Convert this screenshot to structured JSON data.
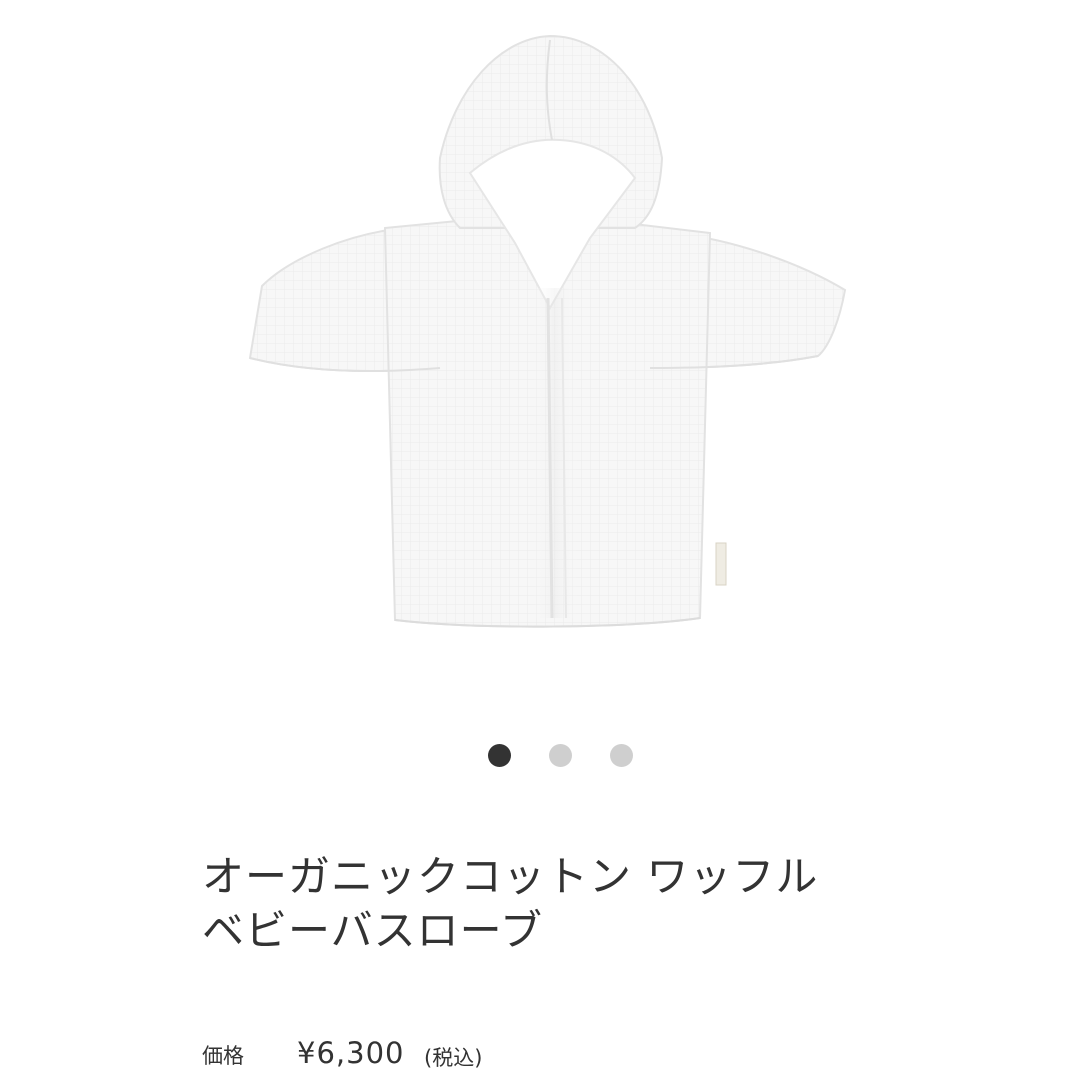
{
  "product": {
    "image_alt": "robe-image",
    "title_line1": "オーガニックコットン ワッフル",
    "title_line2": "ベビーバスローブ"
  },
  "carousel": {
    "count": 3,
    "active_index": 0
  },
  "price": {
    "label": "価格",
    "value": "¥6,300",
    "tax": "(税込)"
  }
}
